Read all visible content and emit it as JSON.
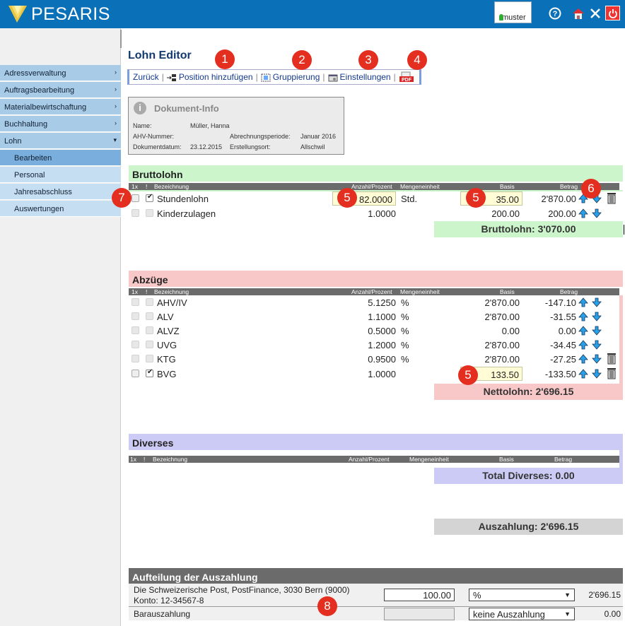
{
  "header": {
    "logo_text": "PESARIS",
    "user": "muster",
    "colors": {
      "bar": "#0a70b8"
    }
  },
  "header_icons": [
    "help-icon",
    "home-icon",
    "tools-icon",
    "power-icon"
  ],
  "sidebar": {
    "items": [
      {
        "label": "Adressverwaltung",
        "arrow": "›"
      },
      {
        "label": "Auftragsbearbeitung",
        "arrow": "›"
      },
      {
        "label": "Materialbewirtschaftung",
        "arrow": "›"
      },
      {
        "label": "Buchhaltung",
        "arrow": "›"
      },
      {
        "label": "Lohn",
        "arrow": "▾"
      },
      {
        "label": "Bearbeiten"
      },
      {
        "label": "Personal"
      },
      {
        "label": "Jahresabschluss"
      },
      {
        "label": "Auswertungen"
      }
    ]
  },
  "page": {
    "title": "Lohn Editor"
  },
  "toolbar": {
    "back": "Zurück",
    "add_position": "Position hinzufügen",
    "grouping": "Gruppierung",
    "settings": "Einstellungen",
    "pdf_icon": "pdf-icon"
  },
  "badges": [
    "1",
    "2",
    "3",
    "4",
    "5",
    "5",
    "5",
    "6",
    "7",
    "8"
  ],
  "docinfo": {
    "title": "Dokument-Info",
    "name_label": "Name:",
    "name": "Müller, Hanna",
    "ahv_label": "AHV-Nummer:",
    "ahv": "",
    "date_label": "Dokumentdatum:",
    "date": "23.12.2015",
    "period_label": "Abrechnungsperiode:",
    "period": "Januar 2016",
    "place_label": "Erstellungsort:",
    "place": "Allschwil"
  },
  "columns": {
    "c1x": "1x",
    "cex": "!",
    "name": "Bezeichnung",
    "qty": "Anzahl/Prozent",
    "unit": "Mengeneinheit",
    "basis": "Basis",
    "amount": "Betrag"
  },
  "brutto": {
    "title": "Bruttolohn",
    "rows": [
      {
        "name": "Stundenlohn",
        "qty": "82.0000",
        "unit": "Std.",
        "basis": "35.00",
        "amount": "2'870.00"
      },
      {
        "name": "Kinderzulagen",
        "qty": "1.0000",
        "unit": "",
        "basis": "200.00",
        "amount": "200.00"
      }
    ],
    "total": "Bruttolohn: 3'070.00"
  },
  "abzuege": {
    "title": "Abzüge",
    "rows": [
      {
        "name": "AHV/IV",
        "qty": "5.1250",
        "unit": "%",
        "basis": "2'870.00",
        "amount": "-147.10"
      },
      {
        "name": "ALV",
        "qty": "1.1000",
        "unit": "%",
        "basis": "2'870.00",
        "amount": "-31.55"
      },
      {
        "name": "ALVZ",
        "qty": "0.5000",
        "unit": "%",
        "basis": "0.00",
        "amount": "0.00"
      },
      {
        "name": "UVG",
        "qty": "1.2000",
        "unit": "%",
        "basis": "2'870.00",
        "amount": "-34.45"
      },
      {
        "name": "KTG",
        "qty": "0.9500",
        "unit": "%",
        "basis": "2'870.00",
        "amount": "-27.25"
      },
      {
        "name": "BVG",
        "qty": "1.0000",
        "unit": "",
        "basis": "133.50",
        "amount": "-133.50"
      }
    ],
    "total": "Nettolohn: 2'696.15"
  },
  "diverses": {
    "title": "Diverses",
    "total": "Total Diverses: 0.00"
  },
  "auszahlung": {
    "total": "Auszahlung: 2'696.15"
  },
  "aufteilung": {
    "title": "Aufteilung der Auszahlung",
    "row1": {
      "line1": "Die Schweizerische Post, PostFinance, 3030 Bern (9000)",
      "line2": "Konto: 12-34567-8",
      "value": "100.00",
      "select": "%",
      "amount": "2'696.15"
    },
    "row2": {
      "label": "Barauszahlung",
      "value": "",
      "select": "keine Auszahlung",
      "amount": "0.00"
    }
  }
}
